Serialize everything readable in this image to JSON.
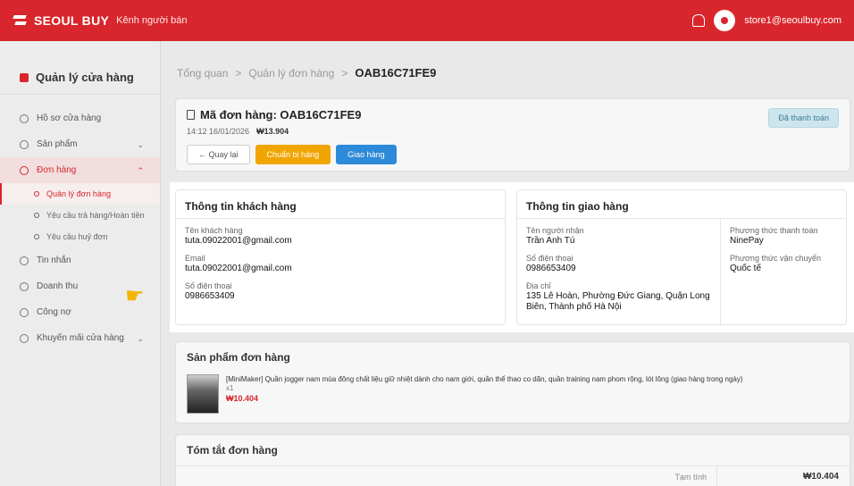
{
  "topbar": {
    "brand": "SEOUL BUY",
    "seller_label": "Kênh người bán",
    "user_email": "store1@seoulbuy.com",
    "icons": [
      "logo-icon",
      "bell-icon",
      "avatar"
    ]
  },
  "sidebar": {
    "store_title": "Quản lý cửa hàng",
    "items": [
      {
        "label": "Hồ sơ cửa hàng",
        "icon": "store-profile-icon"
      },
      {
        "label": "Sản phẩm",
        "icon": "product-icon",
        "chevron": "⌄"
      },
      {
        "label": "Đơn hàng",
        "icon": "cart-icon",
        "chevron": "⌃"
      },
      {
        "label": "Tin nhắn",
        "icon": "message-icon"
      },
      {
        "label": "Doanh thu",
        "icon": "revenue-icon"
      },
      {
        "label": "Công nợ",
        "icon": "debt-icon"
      },
      {
        "label": "Khuyến mãi cửa hàng",
        "icon": "promo-icon",
        "chevron": "⌄"
      }
    ],
    "order_subitems": [
      {
        "label": "Quản lý đơn hàng"
      },
      {
        "label": "Yêu cầu trả hàng/Hoàn tiền"
      },
      {
        "label": "Yêu cầu huỷ đơn"
      }
    ]
  },
  "breadcrumb": {
    "items": [
      "Tổng quan",
      "Quản lý đơn hàng"
    ],
    "current": "OAB16C71FE9",
    "separator": ">"
  },
  "order": {
    "title": "Mã đơn hàng: OAB16C71FE9",
    "datetime": "14:12 16/01/2026",
    "total": "₩13.904",
    "status_badge": "Đã thanh toán",
    "buttons": {
      "back": "← Quay lại",
      "prepare": "Chuẩn bị hàng",
      "ship": "Giao hàng"
    }
  },
  "customer": {
    "heading": "Thông tin khách hàng",
    "name_label": "Tên khách hàng",
    "name": "tuta.09022001@gmail.com",
    "email_label": "Email",
    "email": "tuta.09022001@gmail.com",
    "phone_label": "Số điện thoại",
    "phone": "0986653409"
  },
  "shipping": {
    "heading": "Thông tin giao hàng",
    "recipient_label": "Tên người nhận",
    "recipient": "Trần Anh Tú",
    "phone_label": "Số điện thoại",
    "phone": "0986653409",
    "address_label": "Địa chỉ",
    "address": "135 Lê Hoàn, Phường Đức Giang, Quận Long Biên, Thành phố Hà Nội",
    "payment_label": "Phương thức thanh toán",
    "payment": "NinePay",
    "method_label": "Phương thức vận chuyển",
    "method": "Quốc tế"
  },
  "products": {
    "heading": "Sản phẩm đơn hàng",
    "items": [
      {
        "name": "[MiniMaker] Quần jogger nam mùa đông chất liệu giữ nhiệt dành cho nam giới, quần thể thao co dãn, quần training nam phom rộng, lót lông (giao hàng trong ngày)",
        "qty": "x1",
        "price": "₩10.404"
      }
    ]
  },
  "summary": {
    "heading": "Tóm tắt đơn hàng",
    "subtotal_label": "Tạm tính",
    "subtotal": "₩10.404"
  },
  "colors": {
    "brand_red": "#d8262c",
    "orange": "#f0a500",
    "blue": "#2d8ad8",
    "paid_badge": "#cde6ee"
  }
}
